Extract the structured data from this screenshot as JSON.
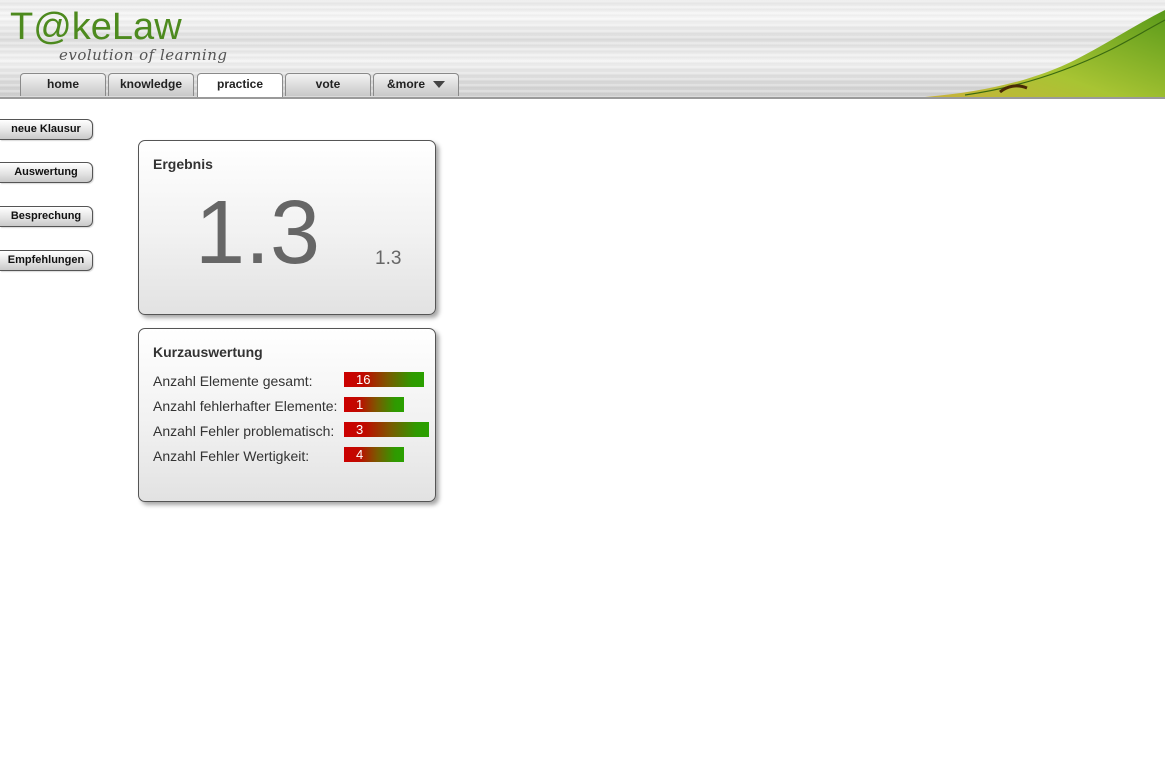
{
  "header": {
    "logo": "T@keLaw",
    "tagline": "evolution of learning"
  },
  "tabs": [
    {
      "label": "home",
      "active": false
    },
    {
      "label": "knowledge",
      "active": false
    },
    {
      "label": "practice",
      "active": true
    },
    {
      "label": "vote",
      "active": false
    },
    {
      "label": "&more",
      "active": false,
      "has_dropdown": true
    }
  ],
  "sidebar": {
    "buttons": [
      "neue Klausur",
      "Auswertung",
      "Besprechung",
      "Empfehlungen"
    ]
  },
  "result": {
    "title": "Ergebnis",
    "grade_large": "1.3",
    "grade_small": "1.3"
  },
  "summary": {
    "title": "Kurzauswertung",
    "rows": [
      {
        "label": "Anzahl Elemente gesamt:",
        "value": "16"
      },
      {
        "label": "Anzahl fehlerhafter Elemente:",
        "value": "1"
      },
      {
        "label": "Anzahl Fehler problematisch:",
        "value": "3"
      },
      {
        "label": "Anzahl Fehler Wertigkeit:",
        "value": "4"
      }
    ]
  },
  "colors": {
    "brand_green": "#4d8a1e",
    "bar_red": "#cc0000",
    "bar_green": "#2aa000"
  }
}
